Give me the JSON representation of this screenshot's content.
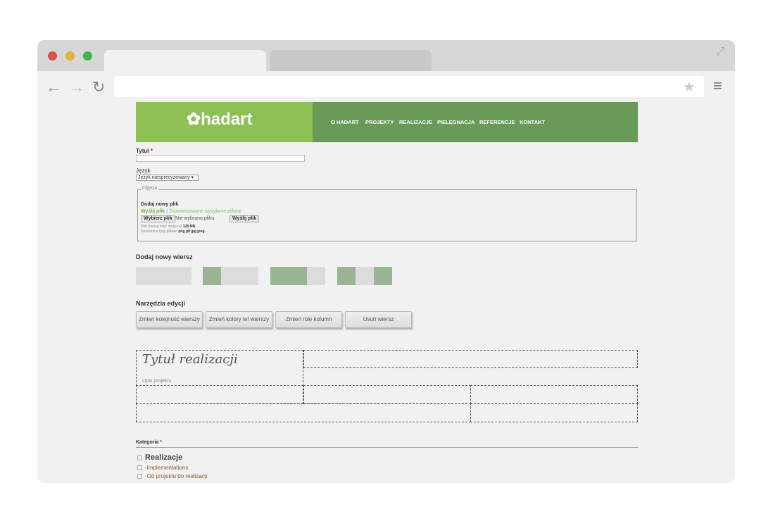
{
  "site": {
    "logo": "hadart",
    "nav": [
      "O HADART",
      "PROJEKTY",
      "REALIZACJE",
      "PIELĘGNACJA",
      "REFERENCJE",
      "KONTAKT"
    ]
  },
  "form": {
    "title_label": "Tytuł",
    "required": "*",
    "title_value": "",
    "lang_label": "Język",
    "lang_value": "Język niesprecyzowany",
    "photos": {
      "legend": "Zdjęcia",
      "add_new": "Dodaj nowy plik",
      "upload_link": "Wyślij plik",
      "sep": "|",
      "advanced_link": "Zaawansowane wysyłanie plików",
      "choose_btn": "Wybierz plik",
      "no_file": "Nie wybrano pliku",
      "send_btn": "Wyślij plik",
      "size_note": "Pliki muszą mieć mniej niż",
      "size_val": "128 MB.",
      "types_note": "Dozwolone typy plików:",
      "types_val": "png gif jpg jpeg."
    },
    "add_row": "Dodaj nowy wiersz",
    "tools": {
      "heading": "Narzędzia edycji",
      "buttons": [
        "Zmień kolejność wierszy",
        "Zmień kolory tel wierszy",
        "Zmień rolę kolumn",
        "Usuń wiersz"
      ]
    },
    "grid": {
      "title": "Tytuł realizacji",
      "desc": "Opis projektu"
    },
    "category": {
      "label": "Kategoria",
      "items": [
        "Realizacje",
        "-Implementations",
        "-Od projektu do realizacji"
      ]
    }
  }
}
